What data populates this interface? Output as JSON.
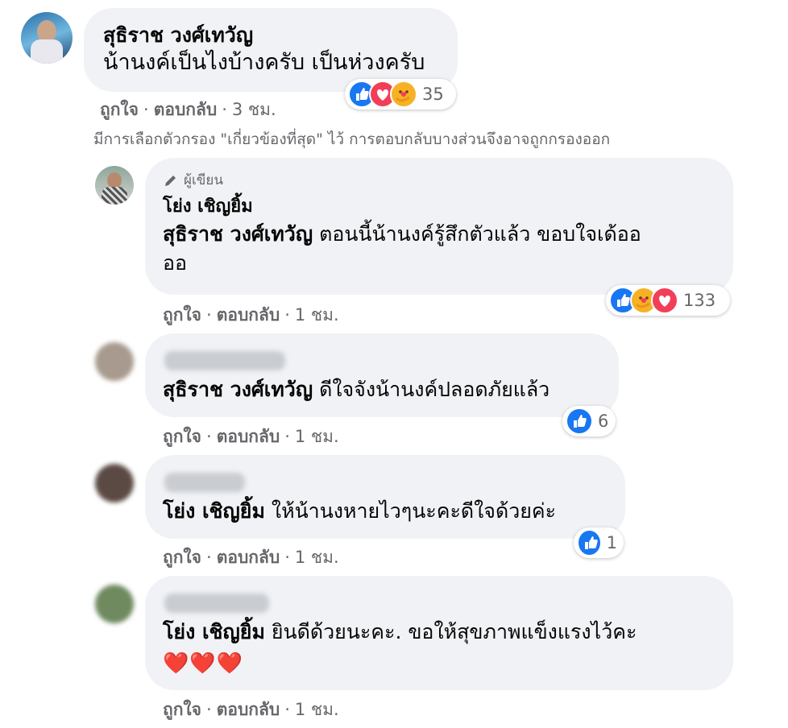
{
  "top_comment": {
    "author": "สุธิราช วงศ์เทวัญ",
    "text": "น้านงค์เป็นไงบ้างครับ เป็นห่วงครับ",
    "like_label": "ถูกใจ",
    "reply_label": "ตอบกลับ",
    "time": "3 ชม.",
    "reaction_count": "35",
    "reactions": [
      "like-icon",
      "love-icon",
      "care-icon"
    ]
  },
  "filter_note": "มีการเลือกตัวกรอง \"เกี่ยวข้องที่สุด\" ไว้ การตอบกลับบางส่วนจึงอาจถูกกรองออก",
  "replies": [
    {
      "author_badge": "ผู้เขียน",
      "author": "โย่ง เชิญยิ้ม",
      "mention": "สุธิราช วงศ์เทวัญ",
      "text_line1": " ตอนนี้น้านงค์รู้สึกตัวแล้ว ขอบใจเด้ออ",
      "text_line2": "ออ",
      "like_label": "ถูกใจ",
      "reply_label": "ตอบกลับ",
      "time": "1 ชม.",
      "reaction_count": "133"
    },
    {
      "mention": "สุธิราช วงศ์เทวัญ",
      "text": " ดีใจจังน้านงค์ปลอดภัยแล้ว",
      "like_label": "ถูกใจ",
      "reply_label": "ตอบกลับ",
      "time": "1 ชม.",
      "reaction_count": "6"
    },
    {
      "mention": "โย่ง เชิญยิ้ม",
      "text": "  ให้น้านงหายไวๆนะคะดีใจด้วยค่ะ",
      "like_label": "ถูกใจ",
      "reply_label": "ตอบกลับ",
      "time": "1 ชม.",
      "reaction_count": "1"
    },
    {
      "mention": "โย่ง เชิญยิ้ม",
      "text": " ยินดีด้วยนะคะ. ขอให้สุขภาพแข็งแรงไว้คะ",
      "emoji": "❤️❤️❤️",
      "like_label": "ถูกใจ",
      "reply_label": "ตอบกลับ",
      "time": "1 ชม."
    }
  ],
  "colors": {
    "like": "#1877f2",
    "love": "#f33e58",
    "care": "#f7b125",
    "bubble": "#f0f2f5",
    "meta": "#65676b"
  }
}
